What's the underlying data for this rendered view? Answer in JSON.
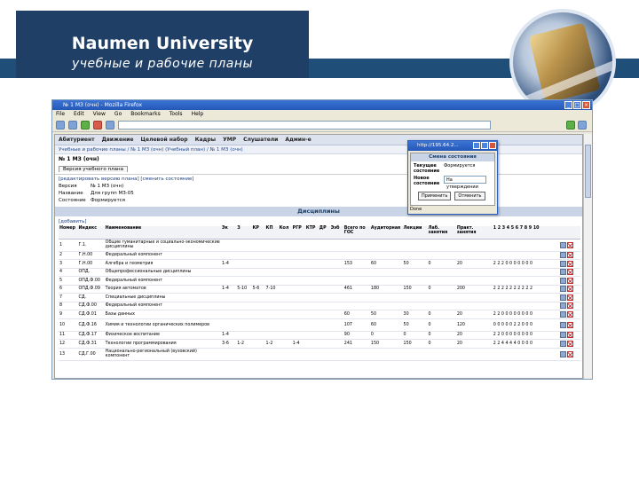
{
  "slide": {
    "title": "Naumen University",
    "subtitle": "учебные и рабочие планы"
  },
  "browser": {
    "window_title": "№ 1 МЗ (очн) - Mozilla Firefox",
    "menu": [
      "File",
      "Edit",
      "View",
      "Go",
      "Bookmarks",
      "Tools",
      "Help"
    ],
    "url": "",
    "status": "Done"
  },
  "app": {
    "menu": [
      "Абитуриент",
      "Движение",
      "Целевой набор",
      "Кадры",
      "УМР",
      "Слушатели",
      "Админ-е"
    ],
    "breadcrumb": "Учебные и рабочие планы / № 1 МЗ (очн) (Учебный план) / № 1 МЗ (очн)",
    "plan_title": "№ 1 МЗ (очн)",
    "tab": "Версия учебного плана",
    "actions": "[редактировать версию плана] [сменить состояние]",
    "info": [
      {
        "key": "Версия",
        "value": "№ 1 МЗ (очн)"
      },
      {
        "key": "Название",
        "value": "Для групп МЗ-05"
      },
      {
        "key": "Состояние",
        "value": "Формируется"
      }
    ],
    "disc_header": "Дисциплины",
    "add_link": "[добавить]",
    "columns": [
      "Номер",
      "Индекс",
      "Наименование",
      "Эк",
      "З",
      "КР",
      "КП",
      "Кол",
      "РГР",
      "КТР",
      "ДР",
      "Ээб",
      "Всего по ГОС",
      "Аудиторная",
      "Лекции",
      "Лаб. занятия",
      "Практ. занятия",
      "1 2 3 4 5 6 7 8 9 10"
    ],
    "rows": [
      [
        "1",
        "Г.1.",
        "Общие гуманитарные и социально-экономические дисциплины",
        "",
        "",
        "",
        "",
        "",
        "",
        "",
        "",
        "",
        "",
        "",
        "",
        "",
        "",
        ""
      ],
      [
        "2",
        "Г.Н.00",
        "Федеральный компонент",
        "",
        "",
        "",
        "",
        "",
        "",
        "",
        "",
        "",
        "",
        "",
        "",
        "",
        "",
        ""
      ],
      [
        "3",
        "Г.Н.00",
        "Алгебра и геометрия",
        "1-4",
        "",
        "",
        "",
        "",
        "",
        "",
        "",
        "",
        "153",
        "60",
        "50",
        "0",
        "20",
        "2 2 2 0 0 0 0 0 0 0"
      ],
      [
        "4",
        "ОПД.",
        "Общепрофессиональные дисциплины",
        "",
        "",
        "",
        "",
        "",
        "",
        "",
        "",
        "",
        "",
        "",
        "",
        "",
        "",
        ""
      ],
      [
        "5",
        "ОПД.Ф.00",
        "Федеральный компонент",
        "",
        "",
        "",
        "",
        "",
        "",
        "",
        "",
        "",
        "",
        "",
        "",
        "",
        "",
        ""
      ],
      [
        "6",
        "ОПД.Ф.09",
        "Теория автоматов",
        "1-4",
        "5-10",
        "5-6",
        "7-10",
        "",
        "",
        "",
        "",
        "",
        "461",
        "180",
        "150",
        "0",
        "200",
        "2 2 2 2 2 2 2 2 2 2"
      ],
      [
        "7",
        "СД.",
        "Специальные дисциплины",
        "",
        "",
        "",
        "",
        "",
        "",
        "",
        "",
        "",
        "",
        "",
        "",
        "",
        "",
        ""
      ],
      [
        "8",
        "СД.Ф.00",
        "Федеральный компонент",
        "",
        "",
        "",
        "",
        "",
        "",
        "",
        "",
        "",
        "",
        "",
        "",
        "",
        "",
        ""
      ],
      [
        "9",
        "СД.Ф.01",
        "Базы данных",
        "",
        "",
        "",
        "",
        "",
        "",
        "",
        "",
        "",
        "60",
        "50",
        "30",
        "0",
        "20",
        "2 2 0 0 0 0 0 0 0 0"
      ],
      [
        "10",
        "СД.Ф.16",
        "Химия и технологии органических полимеров",
        "",
        "",
        "",
        "",
        "",
        "",
        "",
        "",
        "",
        "107",
        "60",
        "50",
        "0",
        "120",
        "0 0 0 0 0 2 2 0 0 0"
      ],
      [
        "11",
        "СД.Ф.17",
        "Физическое воспитание",
        "1-4",
        "",
        "",
        "",
        "",
        "",
        "",
        "",
        "",
        "90",
        "0",
        "0",
        "0",
        "20",
        "2 2 0 0 0 0 0 0 0 0"
      ],
      [
        "12",
        "СД.Ф.31",
        "Технологии программирования",
        "3-6",
        "1-2",
        "",
        "1-2",
        "",
        "1-4",
        "",
        "",
        "",
        "241",
        "150",
        "150",
        "0",
        "20",
        "2 2 4 4 4 4 0 0 0 0"
      ],
      [
        "13",
        "СД.Г.00",
        "Национально-региональный (вузовский) компонент",
        "",
        "",
        "",
        "",
        "",
        "",
        "",
        "",
        "",
        "",
        "",
        "",
        "",
        "",
        ""
      ]
    ]
  },
  "popup": {
    "title": "http://195.64.2...",
    "header": "Смена состояния",
    "current_label": "Текущее состояние",
    "current_value": "Формируется",
    "new_label": "Новое состояние",
    "new_value": "На утверждении",
    "apply_label": "Применить",
    "cancel_label": "Отменить",
    "status": "Done"
  }
}
